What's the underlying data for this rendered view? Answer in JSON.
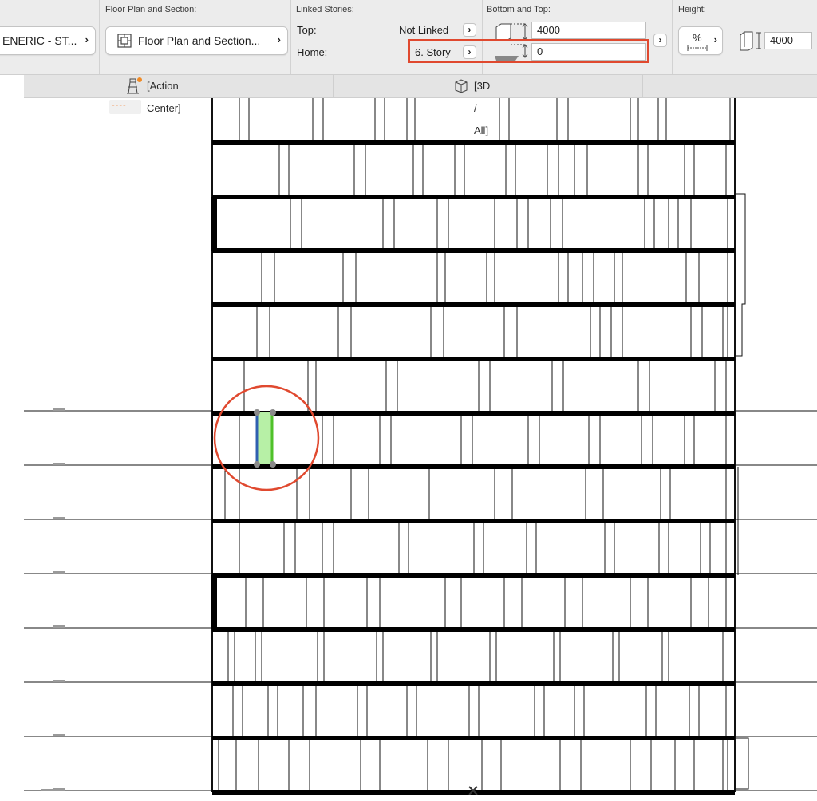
{
  "infobox": {
    "generic_dropdown": "ENERIC - ST...",
    "floor_plan": {
      "title": "Floor Plan and Section:",
      "button_label": "Floor Plan and Section..."
    },
    "linked_stories": {
      "title": "Linked Stories:",
      "top_label": "Top:",
      "top_value": "Not Linked",
      "home_label": "Home:",
      "home_value": "6. Story"
    },
    "bottom_top": {
      "title": "Bottom and Top:",
      "top_offset": "4000",
      "bottom_offset": "0"
    },
    "height": {
      "title": "Height:",
      "percent_symbol": "%",
      "value": "4000"
    },
    "highlight_color": "#e0492f"
  },
  "tabs": [
    {
      "label": "[Action Center]",
      "icon": "lighthouse-icon"
    },
    {
      "label": "[3D / All]",
      "icon": "3d-box-icon"
    }
  ],
  "viewport": {
    "elevation_marker": "----",
    "selection_circle_color": "#e0492f",
    "selected_element_colors": {
      "left_edge": "#2f5fb0",
      "fill": "#b7f0a6",
      "right_edge": "#4fc12a"
    }
  }
}
